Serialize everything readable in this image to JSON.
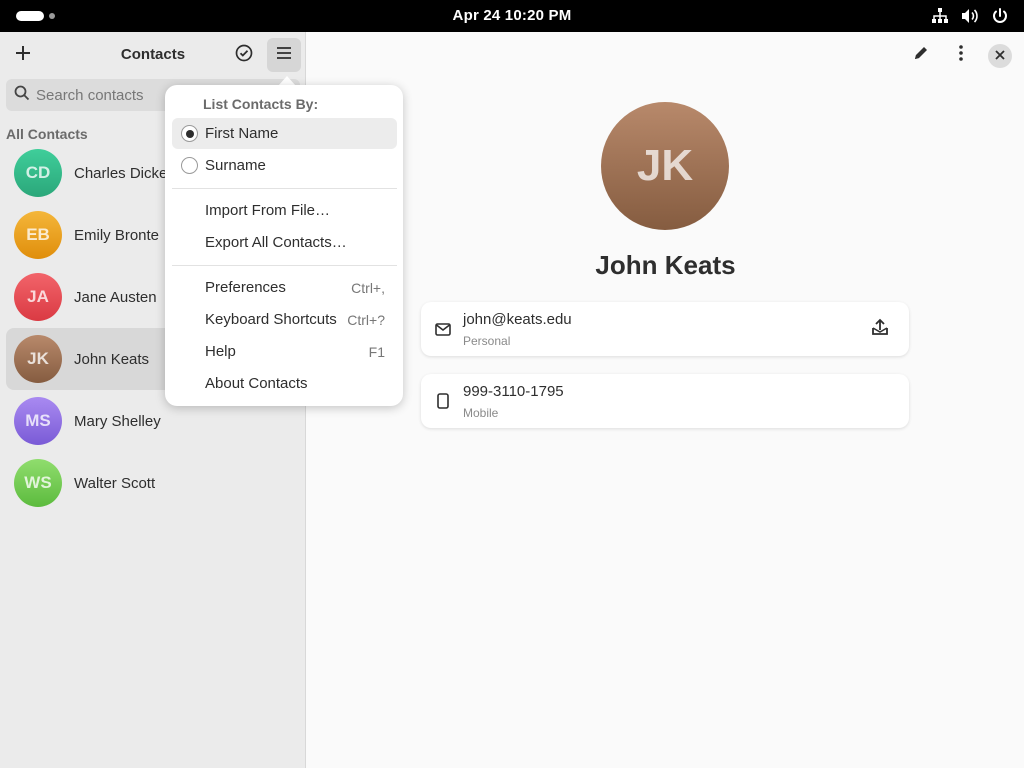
{
  "topbar": {
    "clock": "Apr 24  10:20 PM",
    "tray_icons": [
      "network-icon",
      "volume-icon",
      "power-icon"
    ]
  },
  "sidebar": {
    "title": "Contacts",
    "search_placeholder": "Search contacts",
    "section_label": "All Contacts",
    "contacts": [
      {
        "initials": "CD",
        "name": "Charles Dickens",
        "color_top": "#3fce9a",
        "color_bottom": "#2ba77a",
        "selected": false
      },
      {
        "initials": "EB",
        "name": "Emily Bronte",
        "color_top": "#f4b63a",
        "color_bottom": "#e08e0b",
        "selected": false
      },
      {
        "initials": "JA",
        "name": "Jane Austen",
        "color_top": "#f2646a",
        "color_bottom": "#da3a43",
        "selected": false
      },
      {
        "initials": "JK",
        "name": "John Keats",
        "color_top": "#b8896b",
        "color_bottom": "#855c40",
        "selected": true
      },
      {
        "initials": "MS",
        "name": "Mary Shelley",
        "color_top": "#a98af1",
        "color_bottom": "#7a5bd6",
        "selected": false
      },
      {
        "initials": "WS",
        "name": "Walter Scott",
        "color_top": "#90dd6e",
        "color_bottom": "#5cbb3e",
        "selected": false
      }
    ]
  },
  "main": {
    "avatar_initials": "JK",
    "full_name": "John Keats",
    "email": {
      "value": "john@keats.edu",
      "type": "Personal"
    },
    "phone": {
      "value": "999-3110-1795",
      "type": "Mobile"
    }
  },
  "menu": {
    "heading": "List Contacts By:",
    "sort_options": [
      {
        "label": "First Name",
        "checked": true
      },
      {
        "label": "Surname",
        "checked": false
      }
    ],
    "import_label": "Import From File…",
    "export_label": "Export All Contacts…",
    "preferences": {
      "label": "Preferences",
      "shortcut": "Ctrl+,"
    },
    "shortcuts": {
      "label": "Keyboard Shortcuts",
      "shortcut": "Ctrl+?"
    },
    "help": {
      "label": "Help",
      "shortcut": "F1"
    },
    "about_label": "About Contacts"
  }
}
